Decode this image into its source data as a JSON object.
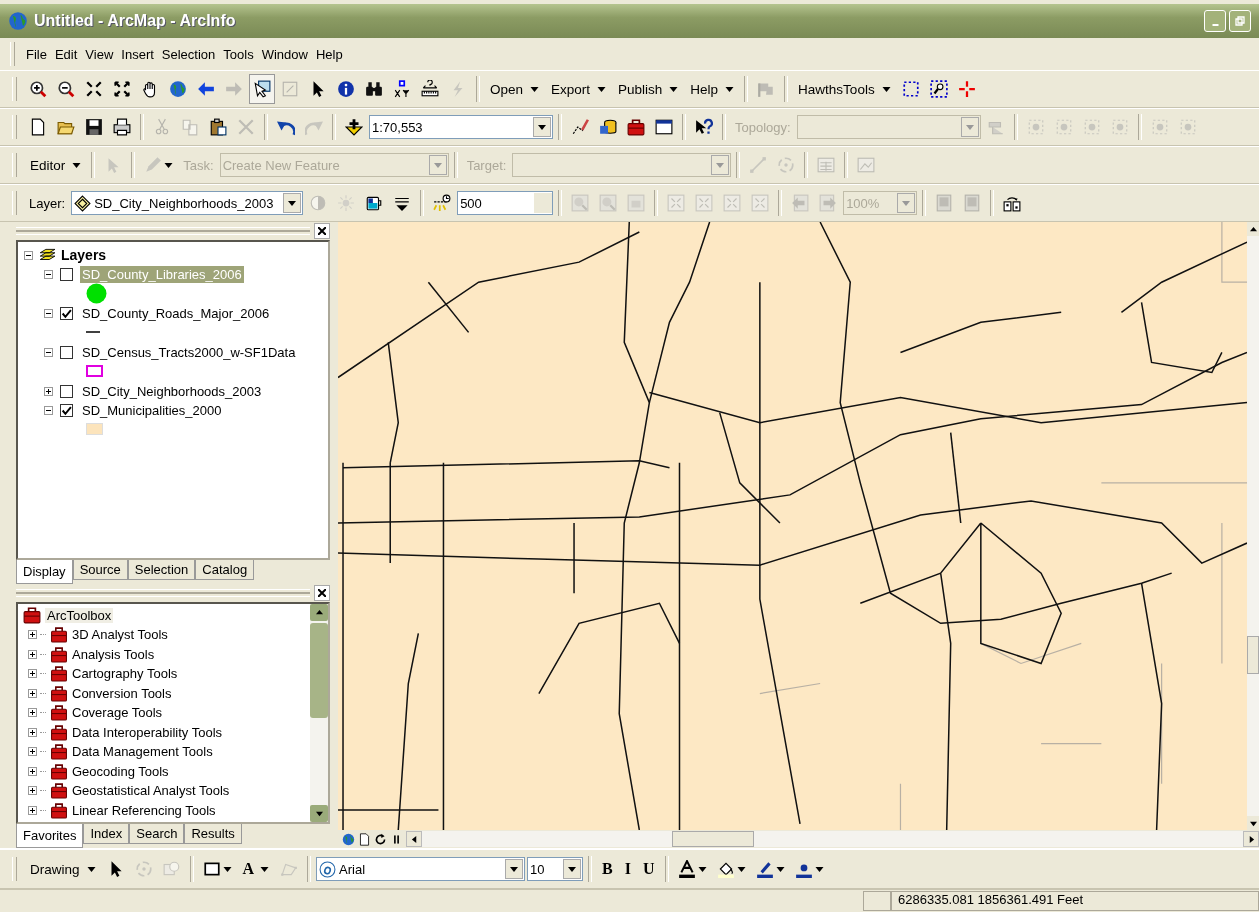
{
  "window": {
    "title": "Untitled - ArcMap - ArcInfo"
  },
  "menu": [
    "File",
    "Edit",
    "View",
    "Insert",
    "Selection",
    "Tools",
    "Window",
    "Help"
  ],
  "toolbars": [
    [
      {
        "kind": "icon",
        "disabled": false
      },
      {
        "kind": "icon",
        "disabled": false
      },
      {
        "kind": "icon",
        "disabled": false
      },
      {
        "kind": "icon",
        "disabled": false
      },
      {
        "kind": "icon",
        "disabled": false
      },
      {
        "kind": "icon",
        "disabled": false
      },
      {
        "kind": "icon",
        "disabled": false
      },
      {
        "kind": "icon",
        "disabled": true
      },
      {
        "kind": "icon",
        "disabled": false,
        "pressed": true
      },
      {
        "kind": "icon",
        "disabled": true
      },
      {
        "kind": "icon",
        "disabled": false
      },
      {
        "kind": "icon",
        "disabled": false
      },
      {
        "kind": "icon",
        "disabled": false
      },
      {
        "kind": "icon",
        "disabled": false
      },
      {
        "kind": "icon",
        "disabled": false
      },
      {
        "kind": "icon",
        "disabled": true
      },
      {
        "kind": "separator"
      },
      {
        "kind": "menu",
        "label": "Open"
      },
      {
        "kind": "menu",
        "label": "Export"
      },
      {
        "kind": "menu",
        "label": "Publish"
      },
      {
        "kind": "menu",
        "label": "Help"
      },
      {
        "kind": "separator"
      },
      {
        "kind": "icon",
        "disabled": true
      },
      {
        "kind": "separator"
      },
      {
        "kind": "menu",
        "label": "HawthsTools"
      },
      {
        "kind": "icon",
        "disabled": false
      },
      {
        "kind": "icon",
        "disabled": false
      },
      {
        "kind": "icon",
        "disabled": false
      }
    ],
    [
      {
        "kind": "icon",
        "disabled": false
      },
      {
        "kind": "icon",
        "disabled": false
      },
      {
        "kind": "icon",
        "disabled": false
      },
      {
        "kind": "icon",
        "disabled": false
      },
      {
        "kind": "separator"
      },
      {
        "kind": "icon",
        "disabled": true
      },
      {
        "kind": "icon",
        "disabled": true
      },
      {
        "kind": "icon",
        "disabled": false
      },
      {
        "kind": "icon",
        "disabled": true
      },
      {
        "kind": "separator"
      },
      {
        "kind": "icon",
        "disabled": false
      },
      {
        "kind": "icon",
        "disabled": true
      },
      {
        "kind": "separator"
      },
      {
        "kind": "icon",
        "disabled": false
      },
      {
        "kind": "combo",
        "value": "1:70,553",
        "disabled": false
      },
      {
        "kind": "separator"
      },
      {
        "kind": "icon",
        "disabled": false
      },
      {
        "kind": "icon",
        "disabled": false
      },
      {
        "kind": "icon",
        "disabled": false
      },
      {
        "kind": "icon",
        "disabled": false
      },
      {
        "kind": "separator"
      },
      {
        "kind": "icon",
        "disabled": false
      },
      {
        "kind": "separator"
      },
      {
        "kind": "label",
        "text": "Topology:",
        "disabled": true
      },
      {
        "kind": "combo",
        "disabled": true
      },
      {
        "kind": "icon",
        "disabled": true
      },
      {
        "kind": "separator"
      },
      {
        "kind": "icon",
        "disabled": true
      },
      {
        "kind": "icon",
        "disabled": true
      },
      {
        "kind": "icon",
        "disabled": true
      },
      {
        "kind": "icon",
        "disabled": true
      },
      {
        "kind": "separator"
      },
      {
        "kind": "icon",
        "disabled": true
      },
      {
        "kind": "icon",
        "disabled": true
      }
    ],
    [
      {
        "kind": "menu",
        "label": "Editor"
      },
      {
        "kind": "separator"
      },
      {
        "kind": "icon",
        "disabled": true
      },
      {
        "kind": "separator"
      },
      {
        "kind": "icon",
        "disabled": true,
        "dropdown": true
      },
      {
        "kind": "label",
        "text": "Task:",
        "disabled": true
      },
      {
        "kind": "combo",
        "value": "Create New Feature",
        "disabled": true
      },
      {
        "kind": "separator"
      },
      {
        "kind": "label",
        "text": "Target:",
        "disabled": true
      },
      {
        "kind": "combo",
        "disabled": true
      },
      {
        "kind": "separator"
      },
      {
        "kind": "icon",
        "disabled": true
      },
      {
        "kind": "icon",
        "disabled": true
      },
      {
        "kind": "separator"
      },
      {
        "kind": "icon",
        "disabled": true
      },
      {
        "kind": "separator"
      },
      {
        "kind": "icon",
        "disabled": true
      }
    ],
    [
      {
        "kind": "label",
        "text": "Layer:",
        "disabled": false
      },
      {
        "kind": "combo",
        "value": "SD_City_Neighborhoods_2003",
        "disabled": false,
        "with_icon": true
      },
      {
        "kind": "icon",
        "disabled": true
      },
      {
        "kind": "icon",
        "disabled": true
      },
      {
        "kind": "icon",
        "disabled": false
      },
      {
        "kind": "icon",
        "disabled": false
      },
      {
        "kind": "separator"
      },
      {
        "kind": "icon",
        "disabled": false
      },
      {
        "kind": "spin",
        "value": "500"
      },
      {
        "kind": "separator"
      },
      {
        "kind": "icon",
        "disabled": true
      },
      {
        "kind": "icon",
        "disabled": true
      },
      {
        "kind": "icon",
        "disabled": true
      },
      {
        "kind": "separator"
      },
      {
        "kind": "icon",
        "disabled": true
      },
      {
        "kind": "icon",
        "disabled": true
      },
      {
        "kind": "icon",
        "disabled": true
      },
      {
        "kind": "icon",
        "disabled": true
      },
      {
        "kind": "separator"
      },
      {
        "kind": "icon",
        "disabled": true
      },
      {
        "kind": "icon",
        "disabled": true
      },
      {
        "kind": "combo",
        "value": "100%",
        "disabled": true
      },
      {
        "kind": "separator"
      },
      {
        "kind": "icon",
        "disabled": true
      },
      {
        "kind": "icon",
        "disabled": true
      },
      {
        "kind": "separator"
      },
      {
        "kind": "icon",
        "disabled": false
      }
    ]
  ],
  "toc": {
    "root": {
      "label": "Layers",
      "expanded": true
    },
    "layers": [
      {
        "name": "SD_County_Libraries_2006",
        "checked": false,
        "expanded": true,
        "selected": true,
        "symbol": {
          "kind": "point",
          "color": "#00e000"
        }
      },
      {
        "name": "SD_County_Roads_Major_2006",
        "checked": true,
        "expanded": true,
        "selected": false,
        "symbol": {
          "kind": "line",
          "color": "#404040"
        }
      },
      {
        "name": "SD_Census_Tracts2000_w-SF1Data",
        "checked": false,
        "expanded": true,
        "selected": false,
        "symbol": {
          "kind": "outline",
          "color": "#e000e0"
        }
      },
      {
        "name": "SD_City_Neighborhoods_2003",
        "checked": false,
        "expanded": false,
        "selected": false
      },
      {
        "name": "SD_Municipalities_2000",
        "checked": true,
        "expanded": true,
        "selected": false,
        "symbol": {
          "kind": "fill",
          "color": "#fce4bc"
        }
      }
    ],
    "tabs": [
      {
        "label": "Display",
        "selected": true
      },
      {
        "label": "Source",
        "selected": false
      },
      {
        "label": "Selection",
        "selected": false
      },
      {
        "label": "Catalog",
        "selected": false
      }
    ]
  },
  "toolbox": {
    "root": "ArcToolbox",
    "items": [
      {
        "label": "3D Analyst Tools",
        "expanded": false
      },
      {
        "label": "Analysis Tools",
        "expanded": false
      },
      {
        "label": "Cartography Tools",
        "expanded": false
      },
      {
        "label": "Conversion Tools",
        "expanded": false
      },
      {
        "label": "Coverage Tools",
        "expanded": false
      },
      {
        "label": "Data Interoperability Tools",
        "expanded": false
      },
      {
        "label": "Data Management Tools",
        "expanded": false
      },
      {
        "label": "Geocoding Tools",
        "expanded": false
      },
      {
        "label": "Geostatistical Analyst Tools",
        "expanded": false
      },
      {
        "label": "Linear Referencing Tools",
        "expanded": false
      }
    ],
    "tabs": [
      {
        "label": "Favorites",
        "selected": true
      },
      {
        "label": "Index",
        "selected": false
      },
      {
        "label": "Search",
        "selected": false
      },
      {
        "label": "Results",
        "selected": false
      }
    ]
  },
  "drawing_toolbar": [
    {
      "kind": "menu",
      "label": "Drawing"
    },
    {
      "kind": "icon",
      "disabled": false
    },
    {
      "kind": "icon",
      "disabled": true
    },
    {
      "kind": "icon",
      "disabled": true
    },
    {
      "kind": "separator"
    },
    {
      "kind": "icon",
      "disabled": false,
      "dropdown": true
    },
    {
      "kind": "text-button",
      "label": "A",
      "dropdown": true
    },
    {
      "kind": "icon",
      "disabled": true
    },
    {
      "kind": "separator"
    },
    {
      "kind": "combo",
      "value": "Arial",
      "disabled": false,
      "with_icon": true
    },
    {
      "kind": "combo",
      "value": "10",
      "disabled": false
    },
    {
      "kind": "separator"
    },
    {
      "kind": "text-button",
      "label": "B",
      "dropdown": false
    },
    {
      "kind": "text-button",
      "label": "I",
      "dropdown": false
    },
    {
      "kind": "text-button",
      "label": "U",
      "dropdown": false
    },
    {
      "kind": "separator"
    },
    {
      "kind": "icon",
      "disabled": false,
      "dropdown": true
    },
    {
      "kind": "icon",
      "disabled": false,
      "dropdown": true
    },
    {
      "kind": "icon",
      "disabled": false,
      "dropdown": true
    },
    {
      "kind": "icon",
      "disabled": false,
      "dropdown": true
    }
  ],
  "status_bar": {
    "coordinates": "6286335.081  1856361.491 Feet"
  }
}
